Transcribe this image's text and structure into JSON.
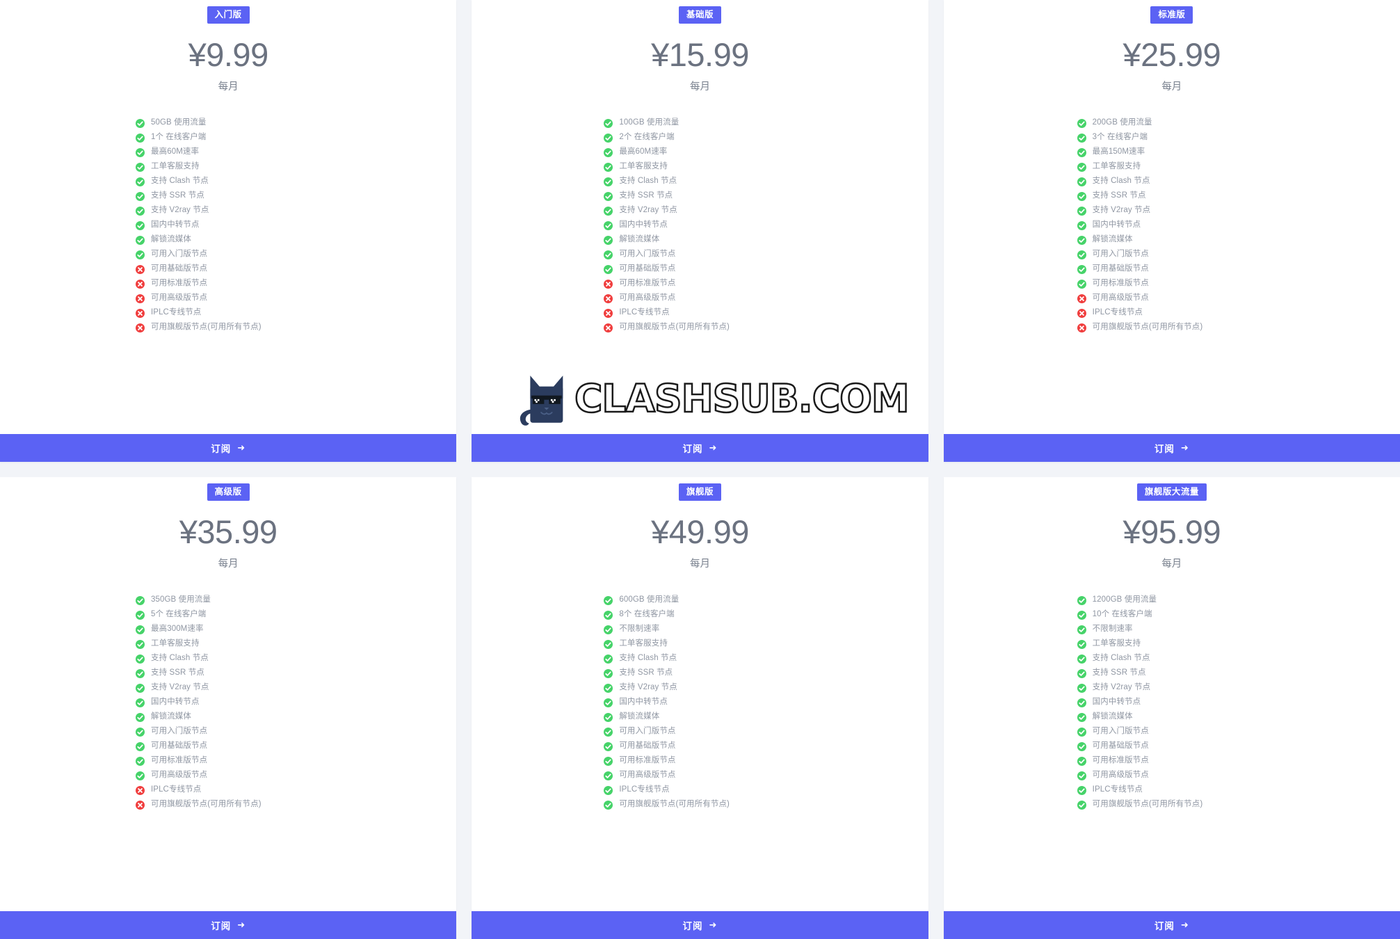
{
  "theme": {
    "accent": "#5b62f4",
    "page_bg": "#f2f4f8",
    "card_bg": "#ffffff",
    "yes_color": "#46d369",
    "no_color": "#f03e3e",
    "price_color": "#6b7280",
    "feature_text_color": "#9097a3"
  },
  "watermark": {
    "text": "CLASHSUB.COM",
    "mascot": "cat-with-sunglasses-icon"
  },
  "common": {
    "period_label": "每月",
    "cta_label": "订阅",
    "cta_arrow": "➜"
  },
  "plans": [
    {
      "badge": "入门版",
      "price": "¥9.99",
      "period": "每月",
      "cta": "订阅",
      "features": [
        {
          "label": "50GB 使用流量",
          "included": true
        },
        {
          "label": "1个 在线客户端",
          "included": true
        },
        {
          "label": "最高60M速率",
          "included": true
        },
        {
          "label": "工单客服支持",
          "included": true
        },
        {
          "label": "支持 Clash 节点",
          "included": true
        },
        {
          "label": "支持 SSR 节点",
          "included": true
        },
        {
          "label": "支持 V2ray 节点",
          "included": true
        },
        {
          "label": "国内中转节点",
          "included": true
        },
        {
          "label": "解锁流媒体",
          "included": true
        },
        {
          "label": "可用入门版节点",
          "included": true
        },
        {
          "label": "可用基础版节点",
          "included": false
        },
        {
          "label": "可用标准版节点",
          "included": false
        },
        {
          "label": "可用高级版节点",
          "included": false
        },
        {
          "label": "IPLC专线节点",
          "included": false
        },
        {
          "label": "可用旗舰版节点(可用所有节点)",
          "included": false
        }
      ]
    },
    {
      "badge": "基础版",
      "price": "¥15.99",
      "period": "每月",
      "cta": "订阅",
      "features": [
        {
          "label": "100GB 使用流量",
          "included": true
        },
        {
          "label": "2个 在线客户端",
          "included": true
        },
        {
          "label": "最高60M速率",
          "included": true
        },
        {
          "label": "工单客服支持",
          "included": true
        },
        {
          "label": "支持 Clash 节点",
          "included": true
        },
        {
          "label": "支持 SSR 节点",
          "included": true
        },
        {
          "label": "支持 V2ray 节点",
          "included": true
        },
        {
          "label": "国内中转节点",
          "included": true
        },
        {
          "label": "解锁流媒体",
          "included": true
        },
        {
          "label": "可用入门版节点",
          "included": true
        },
        {
          "label": "可用基础版节点",
          "included": true
        },
        {
          "label": "可用标准版节点",
          "included": false
        },
        {
          "label": "可用高级版节点",
          "included": false
        },
        {
          "label": "IPLC专线节点",
          "included": false
        },
        {
          "label": "可用旗舰版节点(可用所有节点)",
          "included": false
        }
      ]
    },
    {
      "badge": "标准版",
      "price": "¥25.99",
      "period": "每月",
      "cta": "订阅",
      "features": [
        {
          "label": "200GB 使用流量",
          "included": true
        },
        {
          "label": "3个 在线客户端",
          "included": true
        },
        {
          "label": "最高150M速率",
          "included": true
        },
        {
          "label": "工单客服支持",
          "included": true
        },
        {
          "label": "支持 Clash 节点",
          "included": true
        },
        {
          "label": "支持 SSR 节点",
          "included": true
        },
        {
          "label": "支持 V2ray 节点",
          "included": true
        },
        {
          "label": "国内中转节点",
          "included": true
        },
        {
          "label": "解锁流媒体",
          "included": true
        },
        {
          "label": "可用入门版节点",
          "included": true
        },
        {
          "label": "可用基础版节点",
          "included": true
        },
        {
          "label": "可用标准版节点",
          "included": true
        },
        {
          "label": "可用高级版节点",
          "included": false
        },
        {
          "label": "IPLC专线节点",
          "included": false
        },
        {
          "label": "可用旗舰版节点(可用所有节点)",
          "included": false
        }
      ]
    },
    {
      "badge": "高级版",
      "price": "¥35.99",
      "period": "每月",
      "cta": "订阅",
      "features": [
        {
          "label": "350GB 使用流量",
          "included": true
        },
        {
          "label": "5个 在线客户端",
          "included": true
        },
        {
          "label": "最高300M速率",
          "included": true
        },
        {
          "label": "工单客服支持",
          "included": true
        },
        {
          "label": "支持 Clash 节点",
          "included": true
        },
        {
          "label": "支持 SSR 节点",
          "included": true
        },
        {
          "label": "支持 V2ray 节点",
          "included": true
        },
        {
          "label": "国内中转节点",
          "included": true
        },
        {
          "label": "解锁流媒体",
          "included": true
        },
        {
          "label": "可用入门版节点",
          "included": true
        },
        {
          "label": "可用基础版节点",
          "included": true
        },
        {
          "label": "可用标准版节点",
          "included": true
        },
        {
          "label": "可用高级版节点",
          "included": true
        },
        {
          "label": "IPLC专线节点",
          "included": false
        },
        {
          "label": "可用旗舰版节点(可用所有节点)",
          "included": false
        }
      ]
    },
    {
      "badge": "旗舰版",
      "price": "¥49.99",
      "period": "每月",
      "cta": "订阅",
      "features": [
        {
          "label": "600GB 使用流量",
          "included": true
        },
        {
          "label": "8个 在线客户端",
          "included": true
        },
        {
          "label": "不限制速率",
          "included": true
        },
        {
          "label": "工单客服支持",
          "included": true
        },
        {
          "label": "支持 Clash 节点",
          "included": true
        },
        {
          "label": "支持 SSR 节点",
          "included": true
        },
        {
          "label": "支持 V2ray 节点",
          "included": true
        },
        {
          "label": "国内中转节点",
          "included": true
        },
        {
          "label": "解锁流媒体",
          "included": true
        },
        {
          "label": "可用入门版节点",
          "included": true
        },
        {
          "label": "可用基础版节点",
          "included": true
        },
        {
          "label": "可用标准版节点",
          "included": true
        },
        {
          "label": "可用高级版节点",
          "included": true
        },
        {
          "label": "IPLC专线节点",
          "included": true
        },
        {
          "label": "可用旗舰版节点(可用所有节点)",
          "included": true
        }
      ]
    },
    {
      "badge": "旗舰版大流量",
      "price": "¥95.99",
      "period": "每月",
      "cta": "订阅",
      "features": [
        {
          "label": "1200GB 使用流量",
          "included": true
        },
        {
          "label": "10个 在线客户端",
          "included": true
        },
        {
          "label": "不限制速率",
          "included": true
        },
        {
          "label": "工单客服支持",
          "included": true
        },
        {
          "label": "支持 Clash 节点",
          "included": true
        },
        {
          "label": "支持 SSR 节点",
          "included": true
        },
        {
          "label": "支持 V2ray 节点",
          "included": true
        },
        {
          "label": "国内中转节点",
          "included": true
        },
        {
          "label": "解锁流媒体",
          "included": true
        },
        {
          "label": "可用入门版节点",
          "included": true
        },
        {
          "label": "可用基础版节点",
          "included": true
        },
        {
          "label": "可用标准版节点",
          "included": true
        },
        {
          "label": "可用高级版节点",
          "included": true
        },
        {
          "label": "IPLC专线节点",
          "included": true
        },
        {
          "label": "可用旗舰版节点(可用所有节点)",
          "included": true
        }
      ]
    }
  ]
}
